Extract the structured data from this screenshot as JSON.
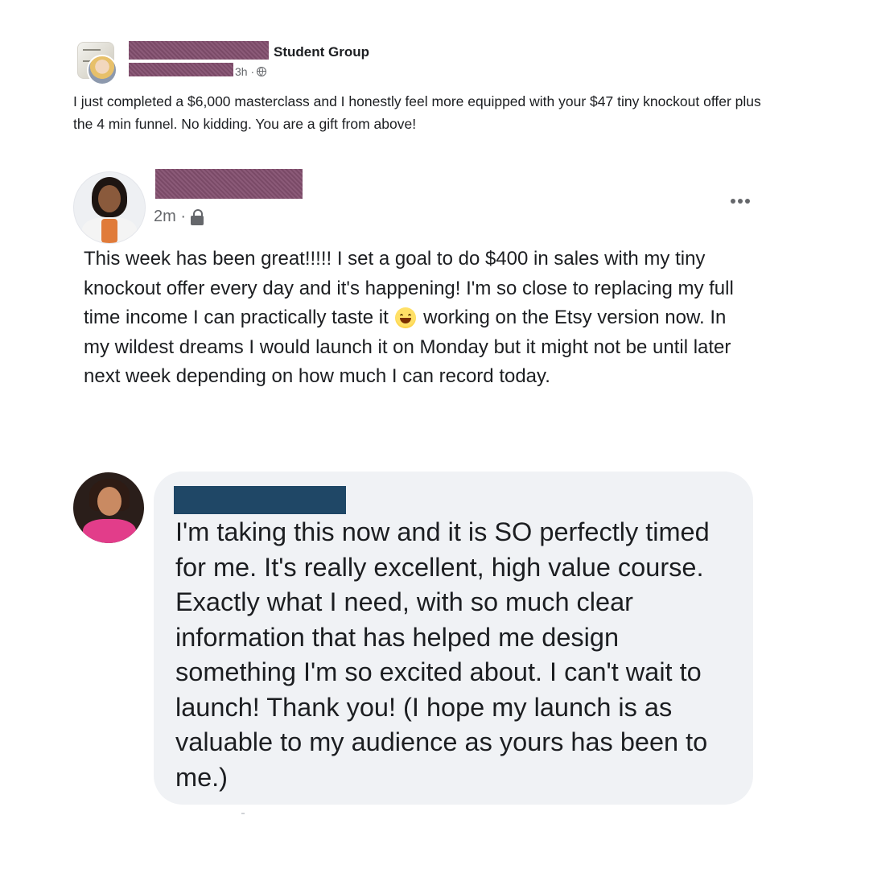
{
  "post1": {
    "group_name": "Student Group",
    "time": "3h ·",
    "icon": "globe-icon",
    "text": "I just completed a $6,000 masterclass and I honestly feel more equipped with your $47 tiny knockout offer plus the 4 min funnel. No kidding. You are a gift from above!"
  },
  "post2": {
    "time": "2m ·",
    "icon": "lock-icon",
    "text_before_emoji": "This week has been great!!!!! I set a goal to do $400 in sales with my tiny knockout offer every day and it's happening! I'm so close to replacing my full time income I can practically taste it ",
    "emoji": "grinning-face-icon",
    "text_after_emoji": " working on the Etsy version now. In my wildest dreams I would launch it on Monday but it might not be until later next week depending on how much I can record today."
  },
  "comment": {
    "text": "I'm taking this now and it is SO perfectly timed for me. It's really excellent, high value course. Exactly what I need, with so much clear information that has helped me design something I'm so excited about. I can't wait to launch! Thank you! (I hope my launch is as valuable to my audience as yours has been to me.)"
  },
  "colors": {
    "redaction_purple": "#7a4a67",
    "redaction_navy": "#1f4766",
    "bubble_bg": "#f0f2f5",
    "meta_gray": "#65676b"
  }
}
